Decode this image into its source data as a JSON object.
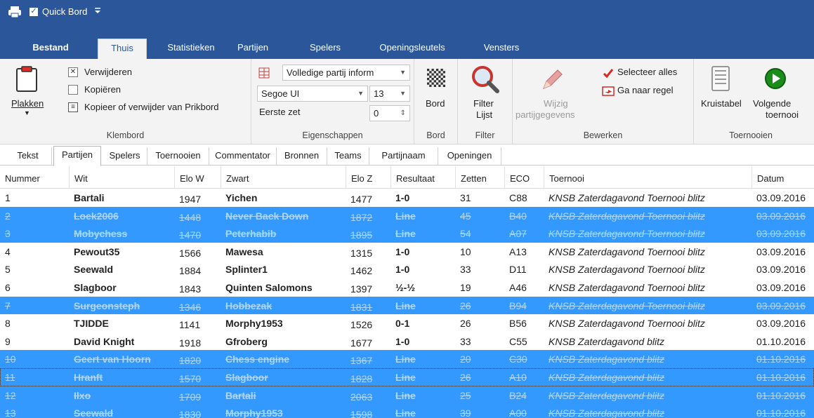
{
  "titlebar": {
    "checkbox_mark": "✓",
    "quick_label": "Quick Bord",
    "caret": "⇧"
  },
  "tabs": [
    {
      "label": "Bestand"
    },
    {
      "label": "Thuis"
    },
    {
      "label": "Statistieken"
    },
    {
      "label": "Partijen"
    },
    {
      "label": "Spelers"
    },
    {
      "label": "Openingsleutels"
    },
    {
      "label": "Vensters"
    }
  ],
  "ribbon": {
    "klembord": {
      "plakken": "Plakken",
      "verwijderen": "Verwijderen",
      "kopieren": "Kopiëren",
      "kopieer_prikbord": "Kopieer of verwijder van Prikbord",
      "label": "Klembord"
    },
    "eigenschappen": {
      "partij_info": "Volledige partij inform",
      "font": "Segoe UI",
      "size": "13",
      "eerste_zet_label": "Eerste zet",
      "eerste_zet_value": "0",
      "label": "Eigenschappen"
    },
    "bord": {
      "button": "Bord",
      "label": "Bord"
    },
    "filter": {
      "button1": "Filter",
      "button2": "Lijst",
      "label": "Filter"
    },
    "bewerken": {
      "wijzig1": "Wijzig",
      "wijzig2": "partijgegevens",
      "selecteer": "Selecteer alles",
      "ganaar": "Ga naar regel",
      "label": "Bewerken"
    },
    "toernooien": {
      "kruistabel": "Kruistabel",
      "volgende1": "Volgende",
      "volgende2": "toernooi",
      "label": "Toernooien"
    }
  },
  "subtabs": [
    "Tekst",
    "Partijen",
    "Spelers",
    "Toernooien",
    "Commentator",
    "Bronnen",
    "Teams",
    "Partijnaam",
    "Openingen"
  ],
  "columns": [
    "Nummer",
    "Wit",
    "Elo W",
    "Zwart",
    "Elo Z",
    "Resultaat",
    "Zetten",
    "ECO",
    "Toernooi",
    "Datum"
  ],
  "rows": [
    {
      "n": "1",
      "wit": "Bartali",
      "elow": "1947",
      "zwart": "Yichen",
      "eloz": "1477",
      "res": "1-0",
      "zet": "31",
      "eco": "C88",
      "toer": "KNSB Zaterdagavond Toernooi blitz",
      "datum": "03.09.2016",
      "sel": false
    },
    {
      "n": "2",
      "wit": "Loek2006",
      "elow": "1448",
      "zwart": "Never Back Down",
      "eloz": "1872",
      "res": "Line",
      "zet": "45",
      "eco": "B40",
      "toer": "KNSB Zaterdagavond Toernooi blitz",
      "datum": "03.09.2016",
      "sel": true
    },
    {
      "n": "3",
      "wit": "Mobychess",
      "elow": "1470",
      "zwart": "Peterhabib",
      "eloz": "1895",
      "res": "Line",
      "zet": "54",
      "eco": "A07",
      "toer": "KNSB Zaterdagavond Toernooi blitz",
      "datum": "03.09.2016",
      "sel": true
    },
    {
      "n": "4",
      "wit": "Pewout35",
      "elow": "1566",
      "zwart": "Mawesa",
      "eloz": "1315",
      "res": "1-0",
      "zet": "10",
      "eco": "A13",
      "toer": "KNSB Zaterdagavond Toernooi blitz",
      "datum": "03.09.2016",
      "sel": false
    },
    {
      "n": "5",
      "wit": "Seewald",
      "elow": "1884",
      "zwart": "Splinter1",
      "eloz": "1462",
      "res": "1-0",
      "zet": "33",
      "eco": "D11",
      "toer": "KNSB Zaterdagavond Toernooi blitz",
      "datum": "03.09.2016",
      "sel": false
    },
    {
      "n": "6",
      "wit": "Slagboor",
      "elow": "1843",
      "zwart": "Quinten Salomons",
      "eloz": "1397",
      "res": "½-½",
      "zet": "19",
      "eco": "A46",
      "toer": "KNSB Zaterdagavond Toernooi blitz",
      "datum": "03.09.2016",
      "sel": false
    },
    {
      "n": "7",
      "wit": "Surgeonsteph",
      "elow": "1346",
      "zwart": "Hobbezak",
      "eloz": "1831",
      "res": "Line",
      "zet": "26",
      "eco": "B94",
      "toer": "KNSB Zaterdagavond Toernooi blitz",
      "datum": "03.09.2016",
      "sel": true
    },
    {
      "n": "8",
      "wit": "TJIDDE",
      "elow": "1141",
      "zwart": "Morphy1953",
      "eloz": "1526",
      "res": "0-1",
      "zet": "26",
      "eco": "B56",
      "toer": "KNSB Zaterdagavond Toernooi blitz",
      "datum": "03.09.2016",
      "sel": false
    },
    {
      "n": "9",
      "wit": "David Knight",
      "elow": "1918",
      "zwart": "Gfroberg",
      "eloz": "1677",
      "res": "1-0",
      "zet": "33",
      "eco": "C55",
      "toer": "KNSB Zaterdagavond blitz",
      "datum": "01.10.2016",
      "sel": false
    },
    {
      "n": "10",
      "wit": "Geert van Hoorn",
      "elow": "1820",
      "zwart": "Chess engine",
      "eloz": "1367",
      "res": "Line",
      "zet": "20",
      "eco": "C30",
      "toer": "KNSB Zaterdagavond blitz",
      "datum": "01.10.2016",
      "sel": true
    },
    {
      "n": "11",
      "wit": "Hranft",
      "elow": "1570",
      "zwart": "Slagboor",
      "eloz": "1828",
      "res": "Line",
      "zet": "26",
      "eco": "A10",
      "toer": "KNSB Zaterdagavond blitz",
      "datum": "01.10.2016",
      "sel": true
    },
    {
      "n": "12",
      "wit": "Ilxo",
      "elow": "1709",
      "zwart": "Bartali",
      "eloz": "2063",
      "res": "Line",
      "zet": "25",
      "eco": "B24",
      "toer": "KNSB Zaterdagavond blitz",
      "datum": "01.10.2016",
      "sel": true
    },
    {
      "n": "13",
      "wit": "Seewald",
      "elow": "1830",
      "zwart": "Morphy1953",
      "eloz": "1598",
      "res": "Line",
      "zet": "39",
      "eco": "A00",
      "toer": "KNSB Zaterdagavond blitz",
      "datum": "01.10.2016",
      "sel": true
    }
  ],
  "colors": {
    "accent": "#2b579a",
    "selection": "#3399ff"
  }
}
